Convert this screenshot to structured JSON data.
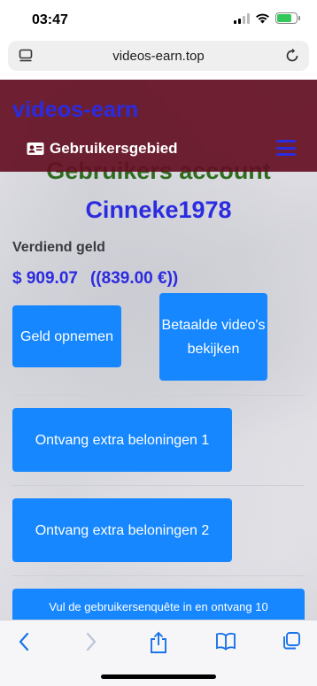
{
  "status_bar": {
    "time": "03:47"
  },
  "browser": {
    "url": "videos-earn.top"
  },
  "site": {
    "brand": "videos-earn",
    "nav_user_label": "Gebruikersgebied",
    "account_title": "Gebruikers account",
    "username": "Cinneke1978",
    "earned_label": "Verdiend geld",
    "earned_usd": "$ 909.07",
    "earned_eur": "((839.00 €))",
    "buttons": {
      "withdraw": "Geld opnemen",
      "watch_paid_videos": "Betaalde video's bekijken",
      "bonus_1": "Ontvang extra beloningen 1",
      "bonus_2": "Ontvang extra beloningen 2",
      "survey": "Vul de gebruikersenquête in en ontvang 10"
    }
  },
  "colors": {
    "header_bg": "#640f23",
    "brand_blue": "#2b2be0",
    "button_blue": "#1687ff",
    "title_green": "#2f6b1e",
    "battery_green": "#34c759"
  },
  "icons": {
    "status": [
      "signal-icon",
      "wifi-icon",
      "battery-icon"
    ],
    "url_bar": [
      "page-menu-icon",
      "reload-icon"
    ],
    "nav": [
      "id-card-icon",
      "hamburger-menu-icon"
    ],
    "toolbar": [
      "back-icon",
      "forward-icon",
      "share-icon",
      "bookmarks-icon",
      "tabs-icon"
    ]
  }
}
